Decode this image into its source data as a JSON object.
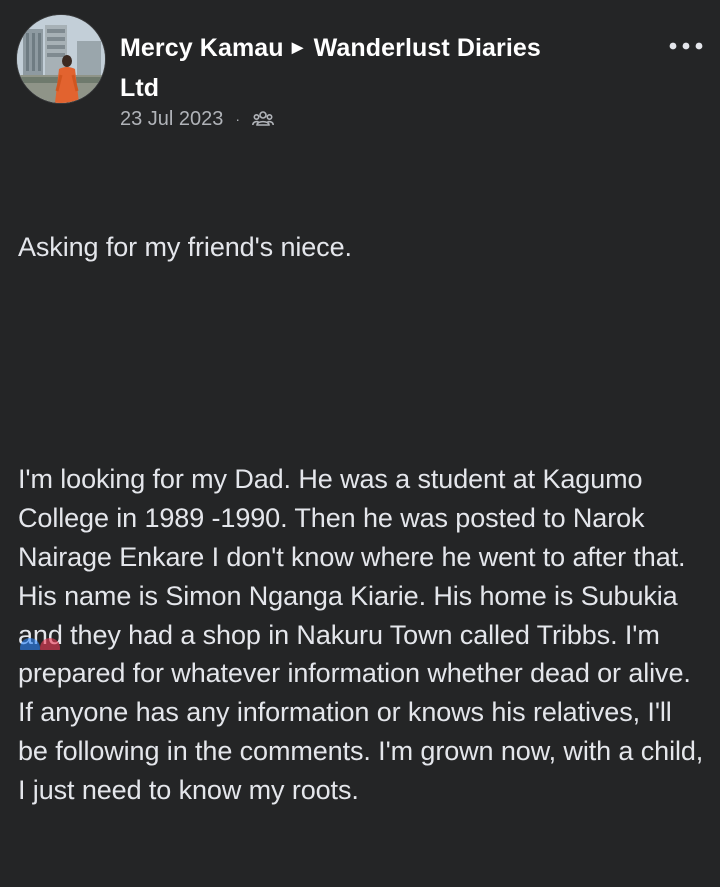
{
  "post": {
    "author": {
      "name": "Mercy Kamau",
      "separator": "►",
      "group": "Wanderlust Diaries",
      "group_line2": "Ltd"
    },
    "date": "23 Jul 2023",
    "meta_separator": "·",
    "audience_icon": "group-icon",
    "more_icon": "more-options-icon",
    "body": {
      "line1": "Asking for my friend's niece.",
      "paragraph2": "I'm looking for my Dad. He was a student at Kagumo College in 1989 -1990. Then he was posted to Narok Nairage Enkare I don't know where he went to after that.   His name is Simon Nganga Kiarie. His home is Subukia and they had a shop in Nakuru Town called Tribbs. I'm prepared for whatever information whether dead or alive. If anyone has any information or knows his relatives, I'll be following in the comments. I'm grown now, with a child, I just need to know my roots."
    }
  },
  "colors": {
    "background": "#242526",
    "primary_text": "#e4e6eb",
    "secondary_text": "#b0b3b8",
    "author_text": "#ffffff"
  }
}
